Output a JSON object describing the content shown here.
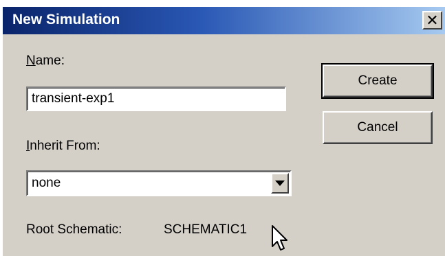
{
  "dialog": {
    "title": "New Simulation",
    "close_symbol": "✕"
  },
  "form": {
    "name_label_accel": "N",
    "name_label_rest": "ame:",
    "name_value": "transient-exp1",
    "inherit_label_accel": "I",
    "inherit_label_rest": "nherit From:",
    "inherit_selected": "none",
    "root_schematic_label": "Root Schematic:",
    "root_schematic_value": "SCHEMATIC1"
  },
  "buttons": {
    "create_label": "Create",
    "cancel_label": "Cancel"
  },
  "icons": {
    "close": "close-icon",
    "dropdown": "chevron-down-icon",
    "cursor": "mouse-pointer-icon"
  },
  "colors": {
    "titlebar_start": "#0a246a",
    "titlebar_end": "#a6caf0",
    "dialog_bg": "#d4d0c8"
  }
}
